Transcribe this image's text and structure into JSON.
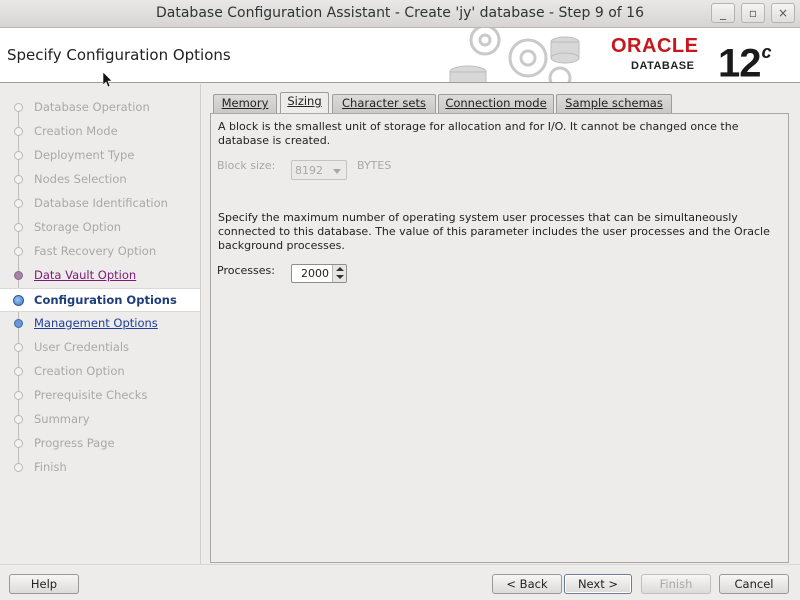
{
  "window": {
    "title": "Database Configuration Assistant - Create 'jy' database - Step 9 of 16",
    "minimize": "_",
    "maximize": "▫",
    "close": "×"
  },
  "header": {
    "page_title": "Specify Configuration Options",
    "logo_brand": "ORACLE",
    "logo_product": "DATABASE",
    "version_number": "12",
    "version_suffix": "c"
  },
  "nav": {
    "items": [
      {
        "label": "Database Operation",
        "state": "disabled"
      },
      {
        "label": "Creation Mode",
        "state": "disabled"
      },
      {
        "label": "Deployment Type",
        "state": "disabled"
      },
      {
        "label": "Nodes Selection",
        "state": "disabled"
      },
      {
        "label": "Database Identification",
        "state": "disabled"
      },
      {
        "label": "Storage Option",
        "state": "disabled"
      },
      {
        "label": "Fast Recovery Option",
        "state": "disabled"
      },
      {
        "label": "Data Vault Option",
        "state": "visited"
      },
      {
        "label": "Configuration Options",
        "state": "current"
      },
      {
        "label": "Management Options",
        "state": "link"
      },
      {
        "label": "User Credentials",
        "state": "disabled"
      },
      {
        "label": "Creation Option",
        "state": "disabled"
      },
      {
        "label": "Prerequisite Checks",
        "state": "disabled"
      },
      {
        "label": "Summary",
        "state": "disabled"
      },
      {
        "label": "Progress Page",
        "state": "disabled"
      },
      {
        "label": "Finish",
        "state": "disabled"
      }
    ]
  },
  "tabs": [
    {
      "label": "Memory",
      "active": false
    },
    {
      "label": "Sizing",
      "active": true
    },
    {
      "label": "Character sets",
      "active": false
    },
    {
      "label": "Connection mode",
      "active": false
    },
    {
      "label": "Sample schemas",
      "active": false
    }
  ],
  "sizing": {
    "block_desc": "A block is the smallest unit of storage for allocation and for I/O. It cannot be changed once the database is created.",
    "block_size_label": "Block size:",
    "block_size_value": "8192",
    "block_size_unit": "BYTES",
    "process_desc": "Specify the maximum number of operating system user processes that can be simultaneously connected to this database. The value of this parameter includes the user processes and the Oracle background processes.",
    "processes_label": "Processes:",
    "processes_value": "2000"
  },
  "buttons": {
    "help": "Help",
    "back": "< Back",
    "next": "Next >",
    "finish": "Finish",
    "cancel": "Cancel"
  },
  "colors": {
    "accent": "#c8161e",
    "current_step": "#1f3e79",
    "visited_link": "#7a1a76",
    "link": "#1f3e9a"
  }
}
